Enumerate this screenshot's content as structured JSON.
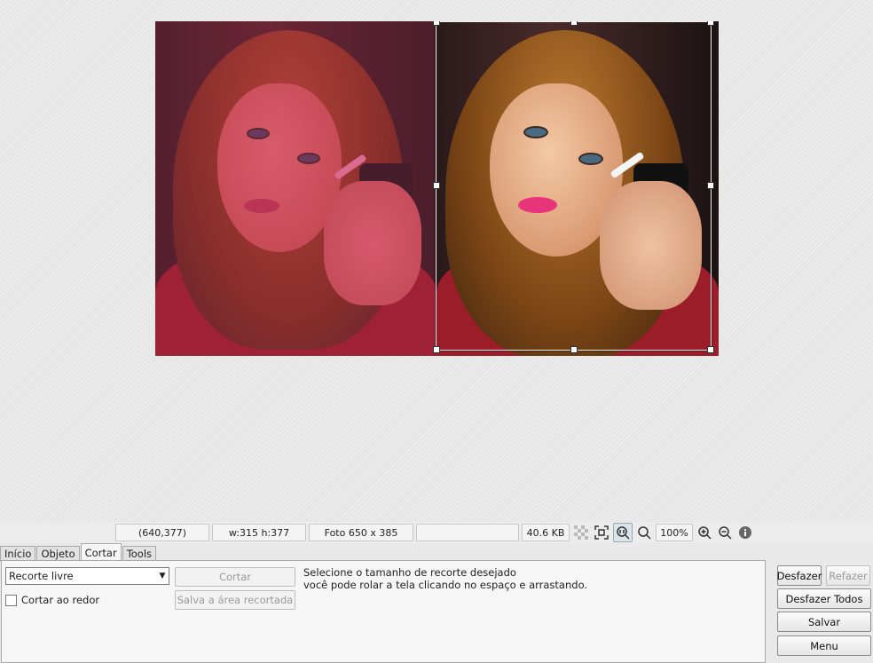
{
  "status": {
    "coords": "(640,377)",
    "size": "w:315 h:377",
    "photo": "Foto 650 x 385",
    "empty": "",
    "filesize": "40.6 KB",
    "zoom": "100%"
  },
  "status_icons": [
    "checker-icon",
    "fit-icon",
    "actual-size-icon",
    "zoom-icon",
    "zoom-in-icon",
    "zoom-out-icon",
    "info-icon"
  ],
  "tabs": [
    {
      "label": "Início",
      "active": false
    },
    {
      "label": "Objeto",
      "active": false
    },
    {
      "label": "Cortar",
      "active": true
    },
    {
      "label": "Tools",
      "active": false
    }
  ],
  "crop": {
    "select_value": "Recorte livre",
    "checkbox_label": "Cortar ao redor",
    "crop_button": "Cortar",
    "save_area_button": "Salva a área recortada",
    "help_line1": "Selecione o tamanho de recorte desejado",
    "help_line2": "você pode rolar a tela clicando no espaço e arrastando."
  },
  "actions": {
    "undo": "Desfazer",
    "redo": "Refazer",
    "undo_all": "Desfazer Todos",
    "save": "Salvar",
    "menu": "Menu"
  },
  "colors": {
    "tint": "#c81e5a",
    "lips": "#e8347a"
  }
}
